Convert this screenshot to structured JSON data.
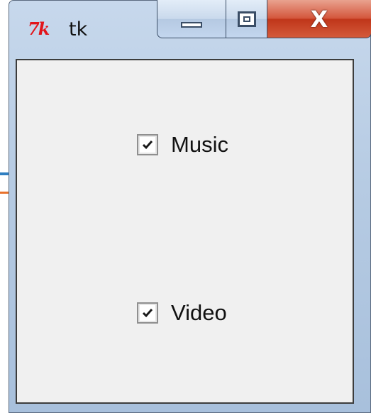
{
  "window": {
    "title": "tk",
    "icon": "tk-logo-icon",
    "logo_text": "7k"
  },
  "caption_buttons": {
    "minimize": "minimize-icon",
    "maximize": "maximize-icon",
    "close": "close-icon",
    "close_glyph": "X"
  },
  "checkboxes": [
    {
      "label": "Music",
      "checked": true
    },
    {
      "label": "Video",
      "checked": true
    }
  ],
  "colors": {
    "tk_logo": "#e2141a",
    "client_bg": "#f0f0f0",
    "close_button": "#c0361a"
  }
}
